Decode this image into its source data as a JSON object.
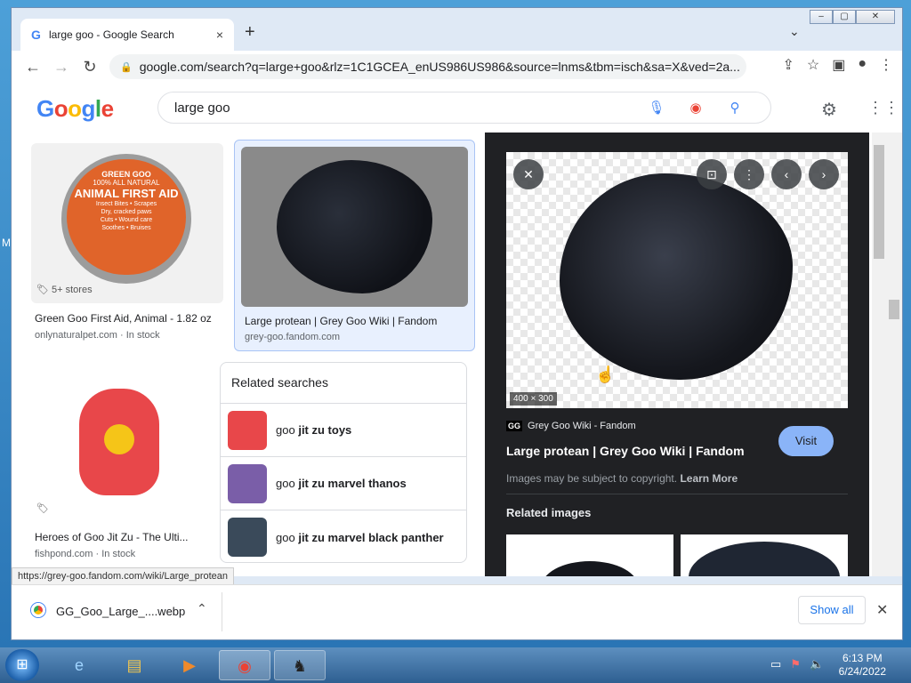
{
  "window": {
    "controls": [
      "–",
      "▢",
      "✕"
    ]
  },
  "browser": {
    "tab_title": "large goo - Google Search",
    "tab_close": "×",
    "new_tab": "+",
    "tab_dropdown": "⌄",
    "url": "google.com/search?q=large+goo&rlz=1C1GCEA_enUS986US986&source=lnms&tbm=isch&sa=X&ved=2a..."
  },
  "google": {
    "logo": "Google",
    "query": "large goo"
  },
  "results": [
    {
      "title": "Green Goo First Aid, Animal - 1.82 oz",
      "source": "onlynaturalpet.com",
      "stock": "In stock",
      "badge": "5+ stores",
      "lid_brand": "GREEN GOO",
      "lid_tag": "100% ALL NATURAL",
      "lid_name": "ANIMAL FIRST AID",
      "lid_lines": [
        "Insect Bites • Scrapes",
        "Dry, cracked paws",
        "Cuts • Wound care",
        "Soothes • Bruises"
      ]
    },
    {
      "title": "Large protean | Grey Goo Wiki | Fandom",
      "source": "grey-goo.fandom.com"
    },
    {
      "title": "Heroes of Goo Jit Zu - The Ulti...",
      "source": "fishpond.com",
      "stock": "In stock"
    }
  ],
  "related": {
    "heading": "Related searches",
    "items": [
      {
        "prefix": "goo",
        "bold": "jit zu toys"
      },
      {
        "prefix": "goo",
        "bold": "jit zu marvel thanos"
      },
      {
        "prefix": "goo",
        "bold": "jit zu marvel black panther"
      }
    ]
  },
  "panel": {
    "dimensions": "400 × 300",
    "site": "Grey Goo Wiki - Fandom",
    "site_icon": "GG",
    "title": "Large protean | Grey Goo Wiki | Fandom",
    "visit": "Visit",
    "copyright": "Images may be subject to copyright.",
    "learn_more": "Learn More",
    "related_images": "Related images"
  },
  "status_url": "https://grey-goo.fandom.com/wiki/Large_protean",
  "download": {
    "file": "GG_Goo_Large_....webp",
    "show_all": "Show all"
  },
  "clock": {
    "time": "6:13 PM",
    "date": "6/24/2022"
  }
}
